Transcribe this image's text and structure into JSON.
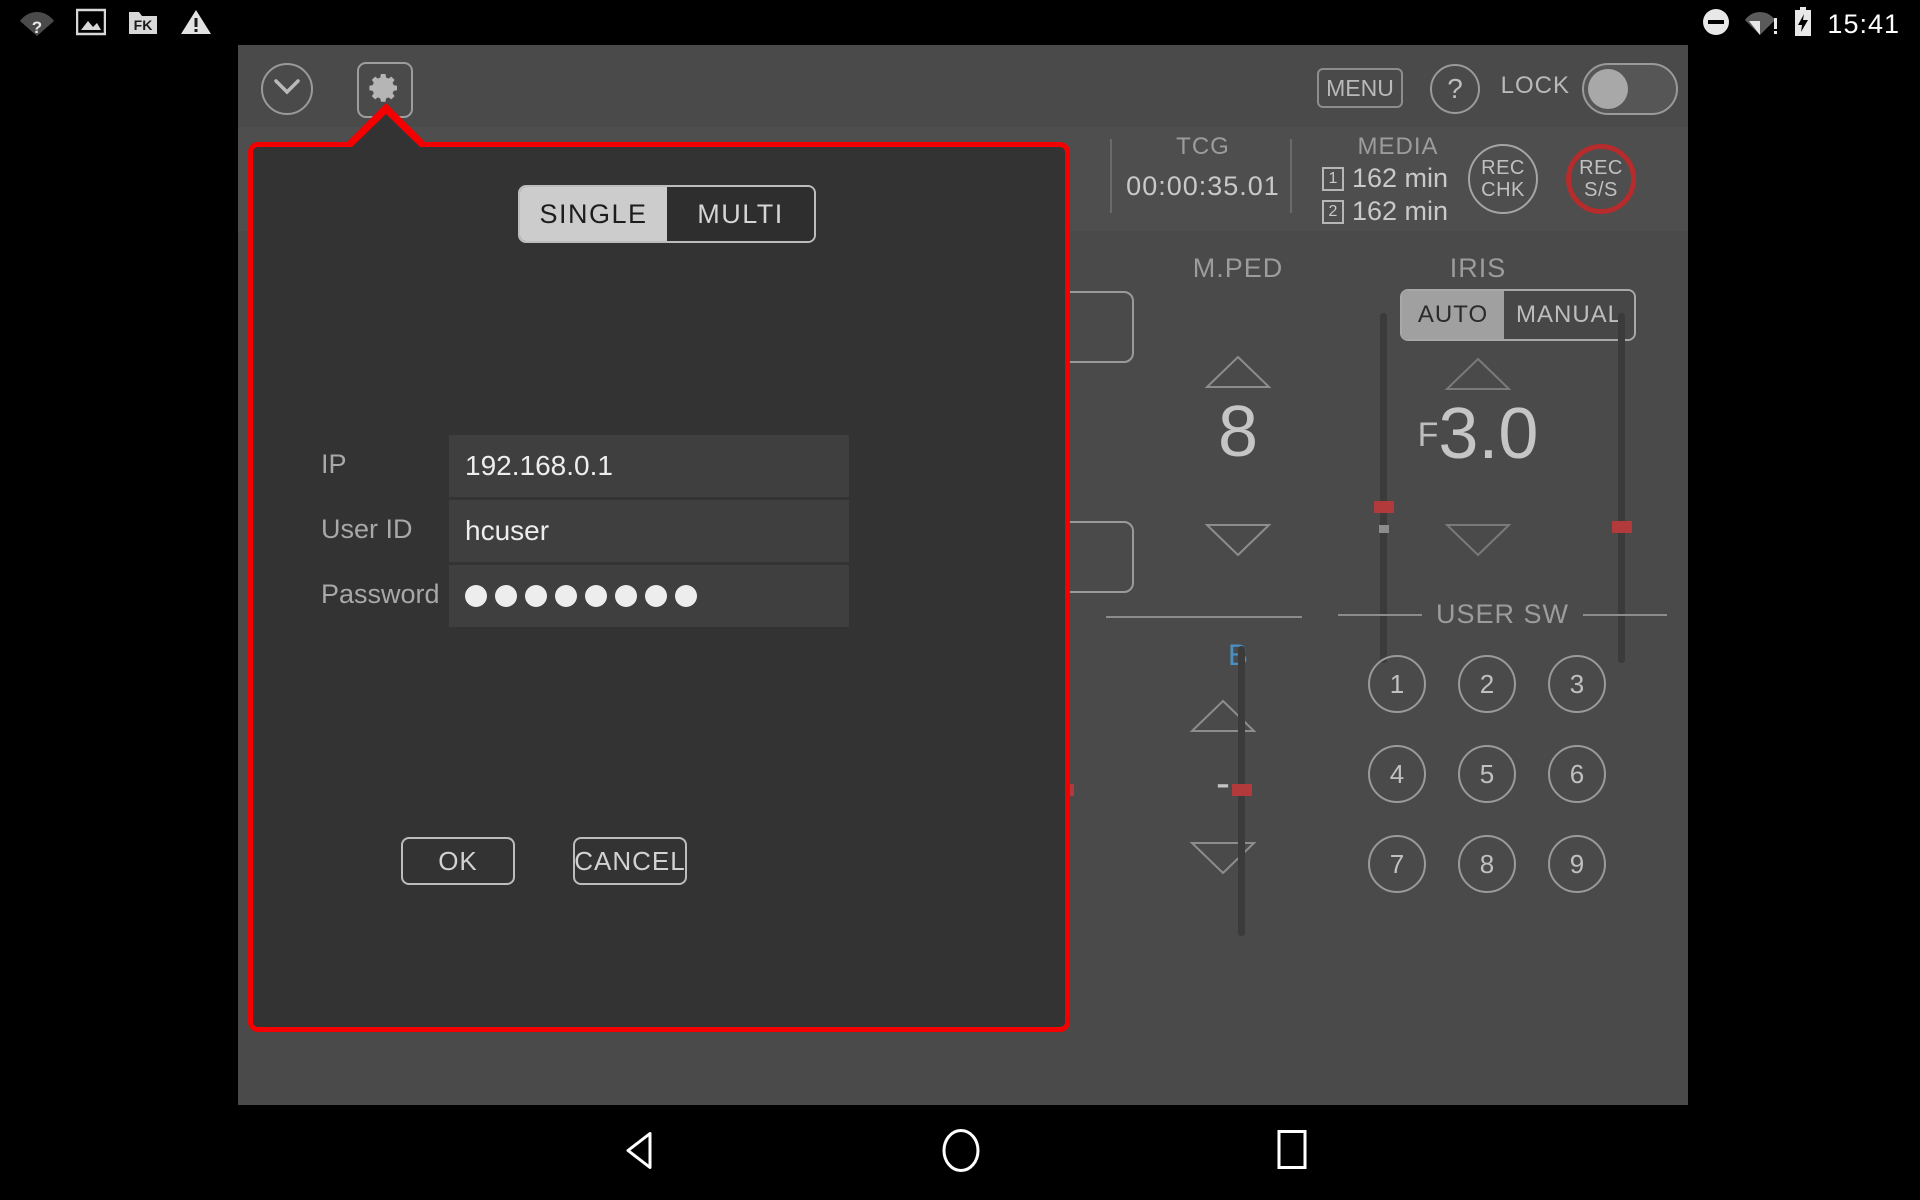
{
  "status_bar": {
    "time": "15:41",
    "left_icons": [
      "wifi-question-icon",
      "image-icon",
      "fx-folder-icon",
      "warning-icon"
    ],
    "right_icons": [
      "do-not-disturb-icon",
      "wifi-alert-icon",
      "battery-charging-icon"
    ]
  },
  "toolbar": {
    "collapse_icon": "chevron-down-icon",
    "settings_icon": "gear-icon",
    "menu_label": "MENU",
    "help_label": "?",
    "lock_label": "LOCK",
    "lock_state": "off"
  },
  "info_strip": {
    "tcg_label": "TCG",
    "tcg_value": "00:00:35.01",
    "media_label": "MEDIA",
    "media_slots": [
      {
        "slot": "1",
        "value": "162 min"
      },
      {
        "slot": "2",
        "value": "162 min"
      }
    ],
    "rec_chk_line1": "REC",
    "rec_chk_line2": "CHK",
    "rec_ss_line1": "REC",
    "rec_ss_line2": "S/S",
    "rec_ss_color": "#b62b2b"
  },
  "mped": {
    "title": "M.PED",
    "value": "8",
    "up_icon": "triangle-up-icon",
    "down_icon": "triangle-down-icon"
  },
  "iris": {
    "title": "IRIS",
    "mode_auto": "AUTO",
    "mode_manual": "MANUAL",
    "selected_mode": "AUTO",
    "value_prefix": "F",
    "value": "3.0",
    "up_icon": "triangle-up-icon",
    "down_icon": "triangle-down-icon"
  },
  "channel_b": {
    "label": "B",
    "value": "-",
    "label_color": "#4a90c4",
    "up_icon": "triangle-up-icon",
    "down_icon": "triangle-down-icon"
  },
  "user_sw": {
    "title": "USER SW",
    "buttons": [
      "1",
      "2",
      "3",
      "4",
      "5",
      "6",
      "7",
      "8",
      "9"
    ]
  },
  "dialog": {
    "border_color": "#f40000",
    "tabs": [
      {
        "label": "SINGLE",
        "selected": true
      },
      {
        "label": "MULTI",
        "selected": false
      }
    ],
    "fields": [
      {
        "label": "IP",
        "value": "192.168.0.1",
        "type": "text"
      },
      {
        "label": "User ID",
        "value": "hcuser",
        "type": "text"
      },
      {
        "label": "Password",
        "value": "",
        "type": "password",
        "dot_count": 8
      }
    ],
    "ok_label": "OK",
    "cancel_label": "CANCEL"
  },
  "nav_bar": {
    "back_icon": "triangle-back-icon",
    "home_icon": "circle-home-icon",
    "recents_icon": "square-recents-icon"
  }
}
